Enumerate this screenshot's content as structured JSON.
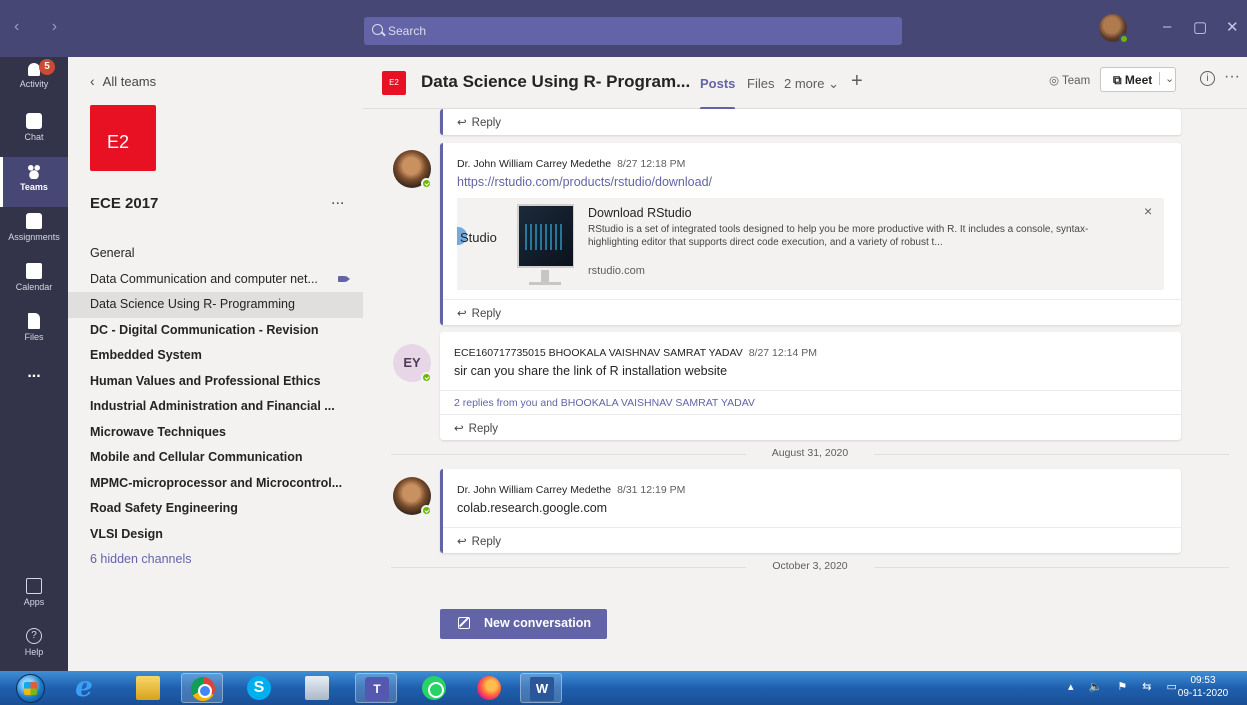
{
  "titlebar": {
    "search_placeholder": "Search",
    "nav_arrows": "‹ ›"
  },
  "rail": {
    "activity": {
      "label": "Activity",
      "badge": "5"
    },
    "chat": {
      "label": "Chat"
    },
    "teams": {
      "label": "Teams"
    },
    "assignments": {
      "label": "Assignments"
    },
    "calendar": {
      "label": "Calendar"
    },
    "files": {
      "label": "Files"
    },
    "more": "...",
    "apps": {
      "label": "Apps"
    },
    "help": {
      "label": "Help",
      "glyph": "?"
    }
  },
  "teampane": {
    "back_label": "All teams",
    "tile_text": "E2",
    "team_name": "ECE 2017",
    "more": "...",
    "channels": [
      {
        "label": "General"
      },
      {
        "label": "Data Communication and computer net..."
      },
      {
        "label": "Data Science Using R- Programming"
      },
      {
        "label": "DC - Digital Communication - Revision"
      },
      {
        "label": "Embedded System"
      },
      {
        "label": "Human Values and Professional Ethics"
      },
      {
        "label": "Industrial Administration and Financial ..."
      },
      {
        "label": "Microwave Techniques"
      },
      {
        "label": "Mobile and Cellular Communication"
      },
      {
        "label": "MPMC-microprocessor and Microcontrol..."
      },
      {
        "label": "Road Safety Engineering"
      },
      {
        "label": "VLSI Design"
      },
      {
        "label": "6 hidden channels"
      }
    ]
  },
  "header": {
    "tile_text": "E2",
    "title": "Data Science Using R- Program...",
    "tabs": {
      "posts": "Posts",
      "files": "Files",
      "more": "2 more ⌄"
    },
    "add_tab": "+",
    "team_label": "◎ Team",
    "meet_label": "⧉ Meet",
    "meet_caret": "⌄",
    "info": "i",
    "more": "···"
  },
  "feed": {
    "reply_label": "Reply",
    "post1": {
      "author": "Dr. John William Carrey Medethe",
      "time": "8/27 12:18 PM",
      "body": "https://rstudio.com/products/rstudio/download/",
      "preview": {
        "title": "Download RStudio",
        "description": "RStudio is a set of integrated tools designed to help you be more productive with R. It includes a console, syntax-highlighting editor that supports direct code execution, and a variety of robust t...",
        "domain": "rstudio.com",
        "thumb_text": "Studio",
        "close": "×"
      }
    },
    "post2": {
      "initials": "EY",
      "author": "ECE160717735015 BHOOKALA VAISHNAV SAMRAT YADAV",
      "time": "8/27 12:14 PM",
      "body": "sir can you share the link of R  installation website",
      "replies": "2 replies from you and BHOOKALA VAISHNAV SAMRAT YADAV"
    },
    "date1": "August 31, 2020",
    "post3": {
      "author": "Dr. John William Carrey Medethe",
      "time": "8/31 12:19 PM",
      "body": "colab.research.google.com"
    },
    "date2": "October 3, 2020",
    "new_conversation": "New conversation"
  },
  "taskbar": {
    "clock_time": "09:53",
    "clock_date": "09-11-2020",
    "skype_letter": "S",
    "teams_letter": "T",
    "word_letter": "W",
    "ie_letter": "e",
    "tray": "▴ 🔈 ⚑ ⇆ ▭"
  },
  "colors": {
    "titlebar": "#464775",
    "rail": "#33344a",
    "accent": "#6264a7",
    "team_tile": "#e81123",
    "online": "#6bb700",
    "badge": "#cc4a31"
  }
}
